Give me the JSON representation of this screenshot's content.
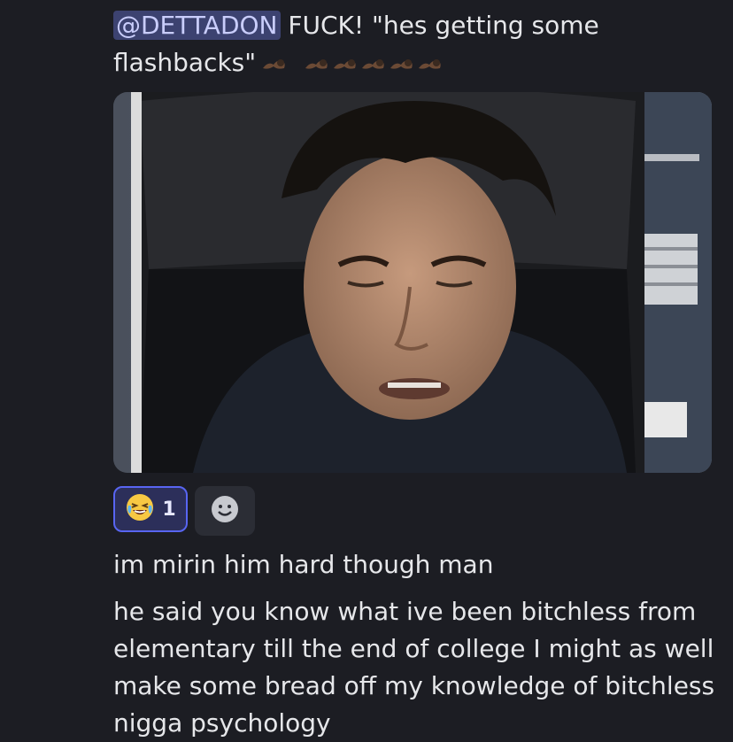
{
  "message1": {
    "mention": "@DETTADON",
    "text": " FUCK! \"hes getting some flashbacks\""
  },
  "emotes": [
    "arm-flex-emote",
    "arm-flex-emote",
    "arm-flex-emote",
    "arm-flex-emote",
    "arm-flex-emote",
    "arm-flex-emote"
  ],
  "reaction": {
    "emoji": "laughing-crying-emoji",
    "count": "1"
  },
  "add_reaction": {
    "icon": "smiley-add-icon"
  },
  "message2": {
    "text": "im mirin him hard though man"
  },
  "message3": {
    "text": "he said you know what ive been bitchless from elementary till the end of college I might as well make some bread off my knowledge of bitchless nigga psychology"
  },
  "colors": {
    "background": "#1c1d23",
    "mention_bg": "#3c4270",
    "mention_text": "#c9cdfb",
    "reaction_border": "#5865f2",
    "reaction_bg": "#2c2f5a",
    "text": "#e6e7ea"
  }
}
